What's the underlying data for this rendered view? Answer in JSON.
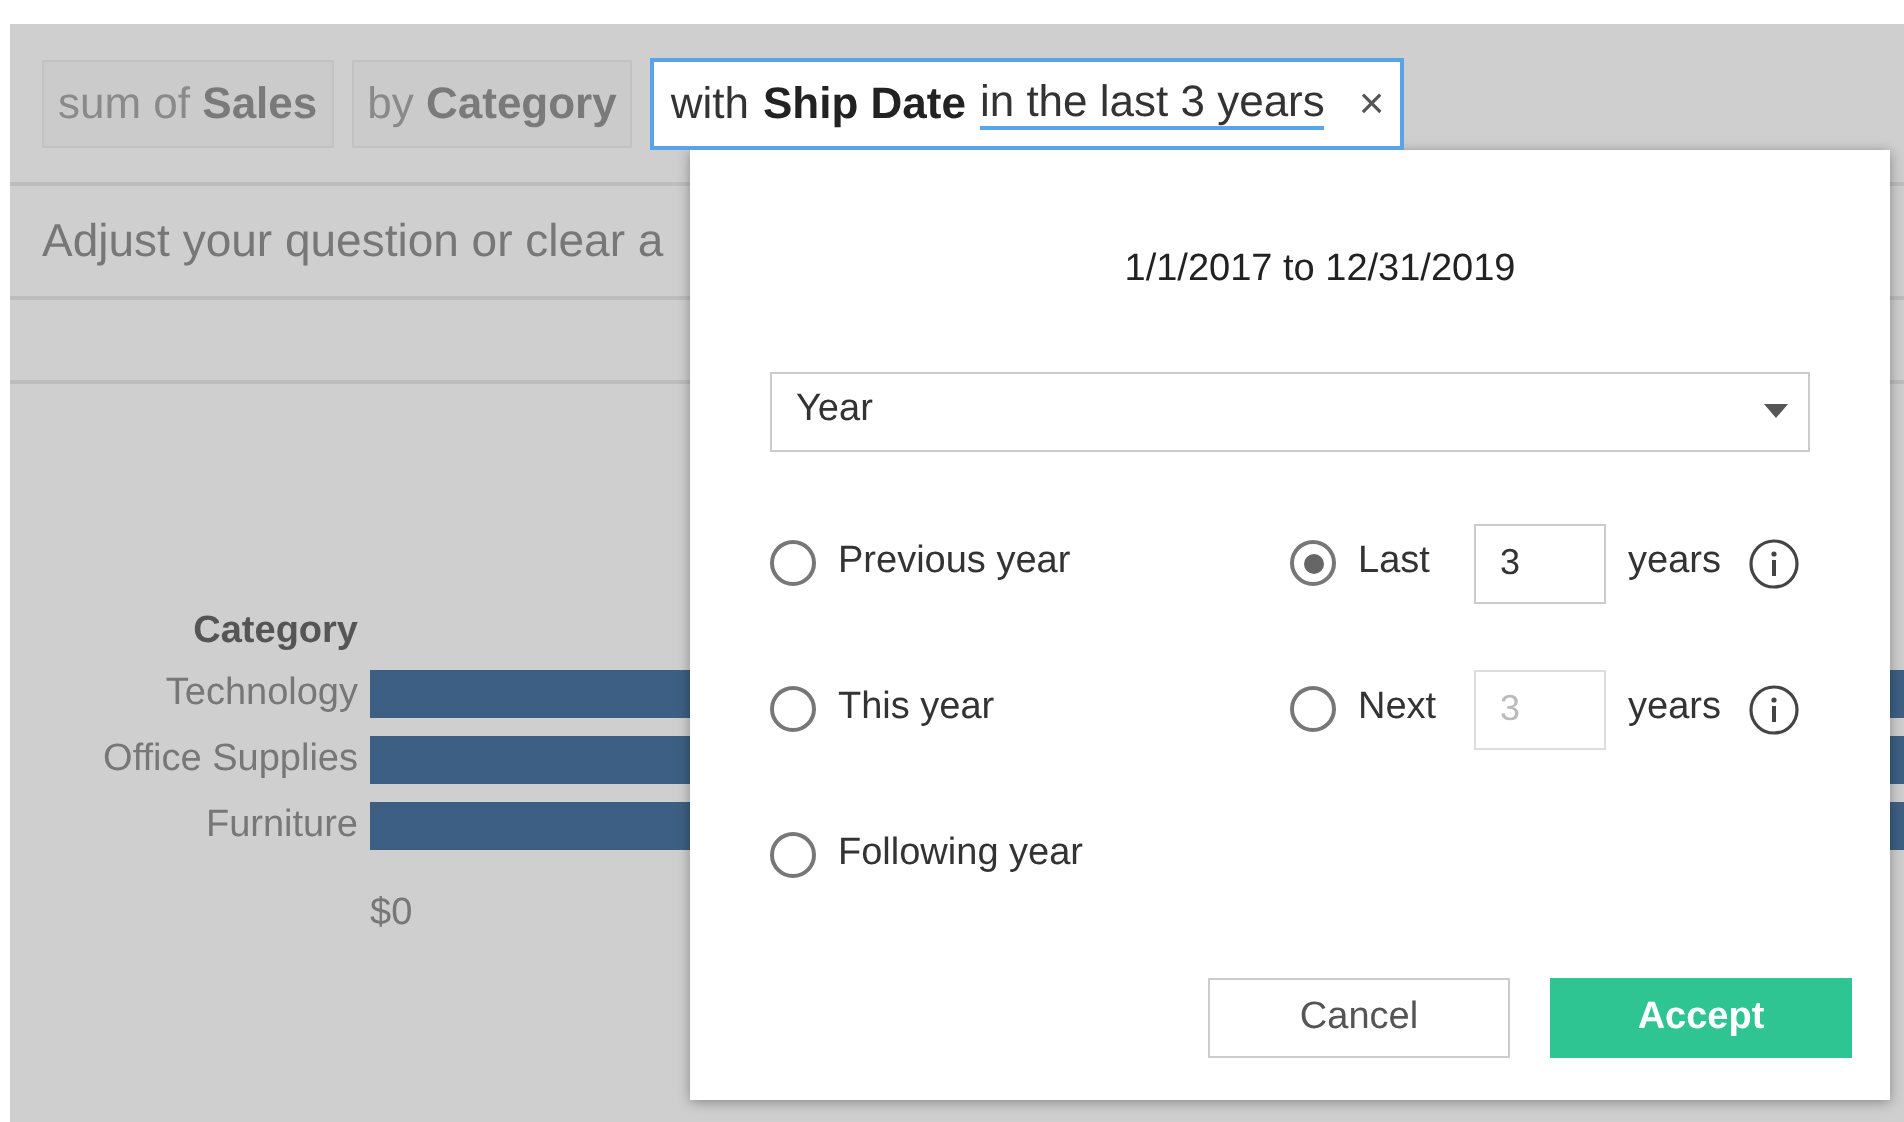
{
  "pills": [
    {
      "text": "sum of **Sales**"
    },
    {
      "text": "by **Category**"
    }
  ],
  "filter_pill": {
    "prefix": "with",
    "field": "Ship Date",
    "condition": "in the last 3 years",
    "close": "×",
    "active": true
  },
  "hint": "Adjust your question or clear a",
  "chart": {
    "axis_title": "Category",
    "categories": [
      "Technology",
      "Office Supplies",
      "Furniture"
    ],
    "tick": "$0"
  },
  "popover": {
    "range_text": "1/1/2017 to 12/31/2019",
    "unit_select": "Year",
    "options": [
      {
        "kind": "preset",
        "label": "Previous year",
        "selected": false
      },
      {
        "kind": "range",
        "label": "Last",
        "value": "3",
        "unit": "years",
        "disabled": false,
        "selected": true
      },
      {
        "kind": "preset",
        "label": "This year",
        "selected": false
      },
      {
        "kind": "range",
        "label": "Next",
        "value": "3",
        "unit": "years",
        "disabled": true,
        "selected": false
      },
      {
        "kind": "preset",
        "label": "Following year",
        "selected": false
      }
    ],
    "buttons": [
      {
        "kind": "secondary",
        "label": "Cancel"
      },
      {
        "kind": "primary",
        "label": "Accept"
      }
    ]
  }
}
